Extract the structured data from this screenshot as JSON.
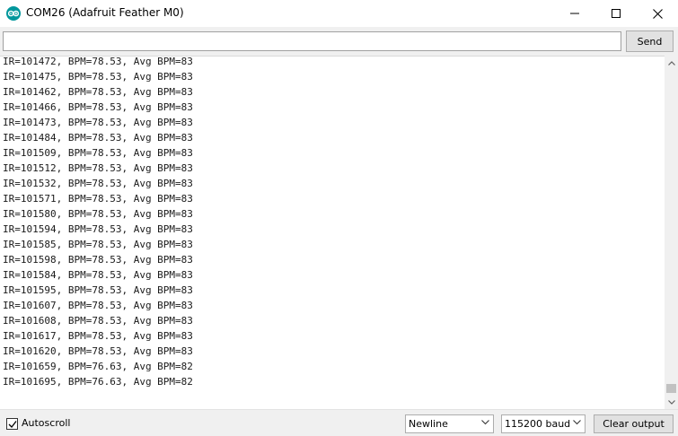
{
  "window": {
    "title": "COM26 (Adafruit Feather M0)",
    "icon": "arduino-icon",
    "accent_color": "#00979c"
  },
  "send": {
    "input_value": "",
    "button_label": "Send"
  },
  "output": {
    "lines": [
      "IR=101472, BPM=78.53, Avg BPM=83",
      "IR=101475, BPM=78.53, Avg BPM=83",
      "IR=101462, BPM=78.53, Avg BPM=83",
      "IR=101466, BPM=78.53, Avg BPM=83",
      "IR=101473, BPM=78.53, Avg BPM=83",
      "IR=101484, BPM=78.53, Avg BPM=83",
      "IR=101509, BPM=78.53, Avg BPM=83",
      "IR=101512, BPM=78.53, Avg BPM=83",
      "IR=101532, BPM=78.53, Avg BPM=83",
      "IR=101571, BPM=78.53, Avg BPM=83",
      "IR=101580, BPM=78.53, Avg BPM=83",
      "IR=101594, BPM=78.53, Avg BPM=83",
      "IR=101585, BPM=78.53, Avg BPM=83",
      "IR=101598, BPM=78.53, Avg BPM=83",
      "IR=101584, BPM=78.53, Avg BPM=83",
      "IR=101595, BPM=78.53, Avg BPM=83",
      "IR=101607, BPM=78.53, Avg BPM=83",
      "IR=101608, BPM=78.53, Avg BPM=83",
      "IR=101617, BPM=78.53, Avg BPM=83",
      "IR=101620, BPM=78.53, Avg BPM=83",
      "IR=101659, BPM=76.63, Avg BPM=82",
      "IR=101695, BPM=76.63, Avg BPM=82"
    ]
  },
  "footer": {
    "autoscroll_label": "Autoscroll",
    "autoscroll_checked": true,
    "line_ending": "Newline",
    "baud_rate": "115200 baud",
    "clear_label": "Clear output"
  }
}
